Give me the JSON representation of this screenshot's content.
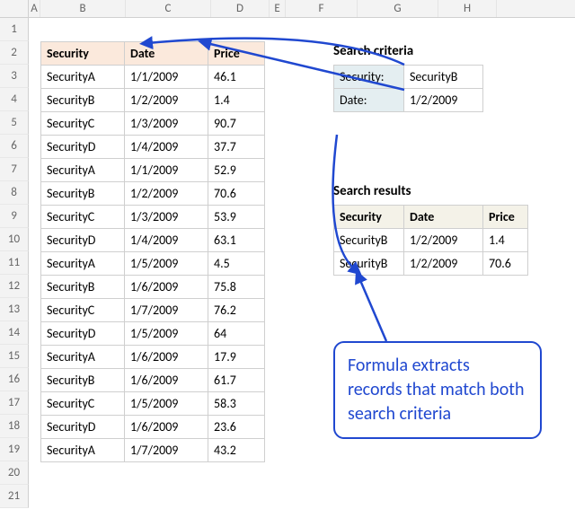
{
  "columns": [
    "A",
    "B",
    "C",
    "D",
    "E",
    "F",
    "G",
    "H"
  ],
  "rows": [
    "1",
    "2",
    "3",
    "4",
    "5",
    "6",
    "7",
    "8",
    "9",
    "10",
    "11",
    "12",
    "13",
    "14",
    "15",
    "16",
    "17",
    "18",
    "19",
    "20",
    "21"
  ],
  "main": {
    "headers": {
      "security": "Security",
      "date": "Date",
      "price": "Price"
    },
    "data": [
      {
        "security": "SecurityA",
        "date": "1/1/2009",
        "price": "46.1"
      },
      {
        "security": "SecurityB",
        "date": "1/2/2009",
        "price": "1.4"
      },
      {
        "security": "SecurityC",
        "date": "1/3/2009",
        "price": "90.7"
      },
      {
        "security": "SecurityD",
        "date": "1/4/2009",
        "price": "37.7"
      },
      {
        "security": "SecurityA",
        "date": "1/1/2009",
        "price": "52.9"
      },
      {
        "security": "SecurityB",
        "date": "1/2/2009",
        "price": "70.6"
      },
      {
        "security": "SecurityC",
        "date": "1/3/2009",
        "price": "53.9"
      },
      {
        "security": "SecurityD",
        "date": "1/4/2009",
        "price": "63.1"
      },
      {
        "security": "SecurityA",
        "date": "1/5/2009",
        "price": "4.5"
      },
      {
        "security": "SecurityB",
        "date": "1/6/2009",
        "price": "75.8"
      },
      {
        "security": "SecurityC",
        "date": "1/7/2009",
        "price": "76.2"
      },
      {
        "security": "SecurityD",
        "date": "1/5/2009",
        "price": "64"
      },
      {
        "security": "SecurityA",
        "date": "1/6/2009",
        "price": "17.9"
      },
      {
        "security": "SecurityB",
        "date": "1/6/2009",
        "price": "61.7"
      },
      {
        "security": "SecurityC",
        "date": "1/5/2009",
        "price": "58.3"
      },
      {
        "security": "SecurityD",
        "date": "1/6/2009",
        "price": "23.6"
      },
      {
        "security": "SecurityA",
        "date": "1/7/2009",
        "price": "43.2"
      }
    ]
  },
  "criteria": {
    "title": "Search criteria",
    "security_label": "Security:",
    "security_value": "SecurityB",
    "date_label": "Date:",
    "date_value": "1/2/2009"
  },
  "results": {
    "title": "Search results",
    "headers": {
      "security": "Security",
      "date": "Date",
      "price": "Price"
    },
    "data": [
      {
        "security": "SecurityB",
        "date": "1/2/2009",
        "price": "1.4"
      },
      {
        "security": "SecurityB",
        "date": "1/2/2009",
        "price": "70.6"
      }
    ]
  },
  "callout": "Formula extracts records that match both search criteria"
}
